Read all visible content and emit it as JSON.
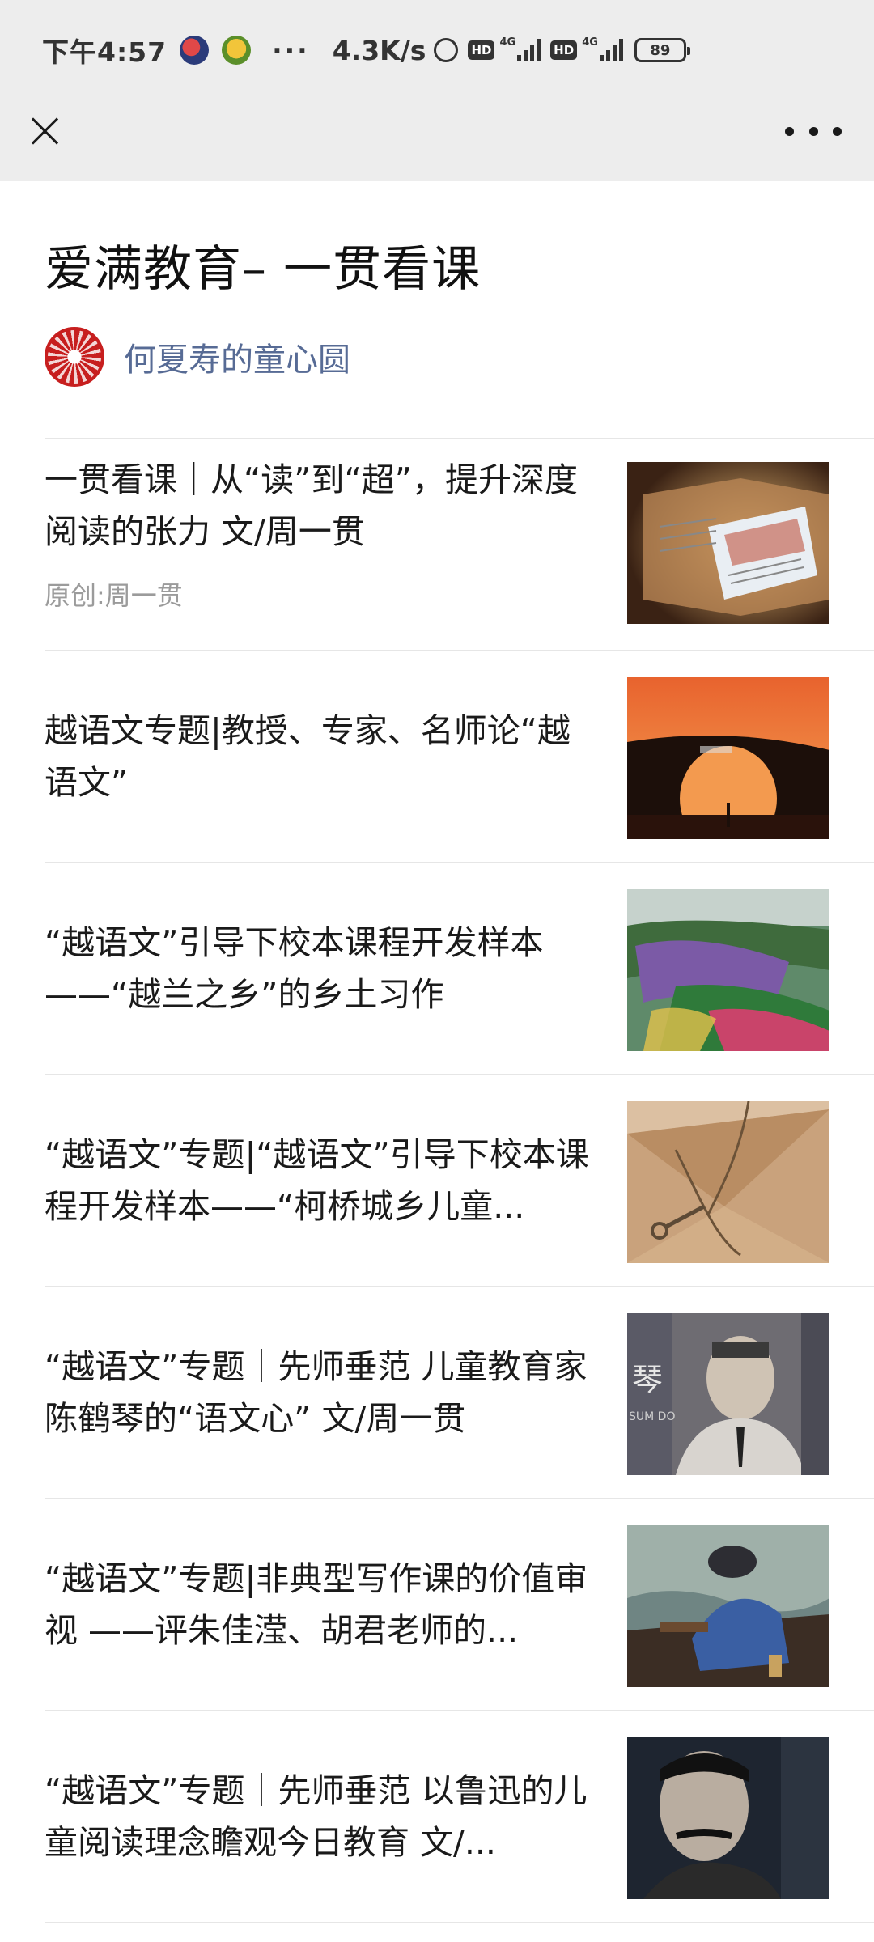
{
  "status_bar": {
    "time": "下午4:57",
    "more": "···",
    "speed": "4.3K/s",
    "hd1": "HD",
    "net1": "4G",
    "hd2": "HD",
    "net2": "4G",
    "battery": "89"
  },
  "page": {
    "title": "爱满教育– 一贯看课",
    "account_name": "何夏寿的童心圆"
  },
  "articles": [
    {
      "title": "一贯看课｜从“读”到“超”，提升深度阅读的张力 文/周一贯",
      "source": "原创:周一贯",
      "thumb_icon": "open-book-image"
    },
    {
      "title": "越语文专题|教授、专家、名师论“越语文”",
      "source": "",
      "thumb_icon": "stone-bridge-sunset-image"
    },
    {
      "title": "“越语文”引导下校本课程开发样本——“越兰之乡”的乡土习作",
      "source": "",
      "thumb_icon": "flower-fields-image"
    },
    {
      "title": "“越语文”专题|“越语文”引导下校本课程开发样本——“柯桥城乡儿童...",
      "source": "",
      "thumb_icon": "envelope-key-image"
    },
    {
      "title": "“越语文”专题｜先师垂范 儿童教育家陈鹤琴的“语文心” 文/周一贯",
      "source": "",
      "thumb_icon": "portrait-image"
    },
    {
      "title": "“越语文”专题|非典型写作课的价值审视 ——评朱佳滢、胡君老师的...",
      "source": "",
      "thumb_icon": "fisherman-boat-image"
    },
    {
      "title": "“越语文”专题｜先师垂范 以鲁迅的儿童阅读理念瞻观今日教育 文/...",
      "source": "",
      "thumb_icon": "lu-xun-portrait-image"
    }
  ],
  "thumb_texts": {
    "portrait_char": "琴",
    "portrait_caption": "SUM DO"
  }
}
